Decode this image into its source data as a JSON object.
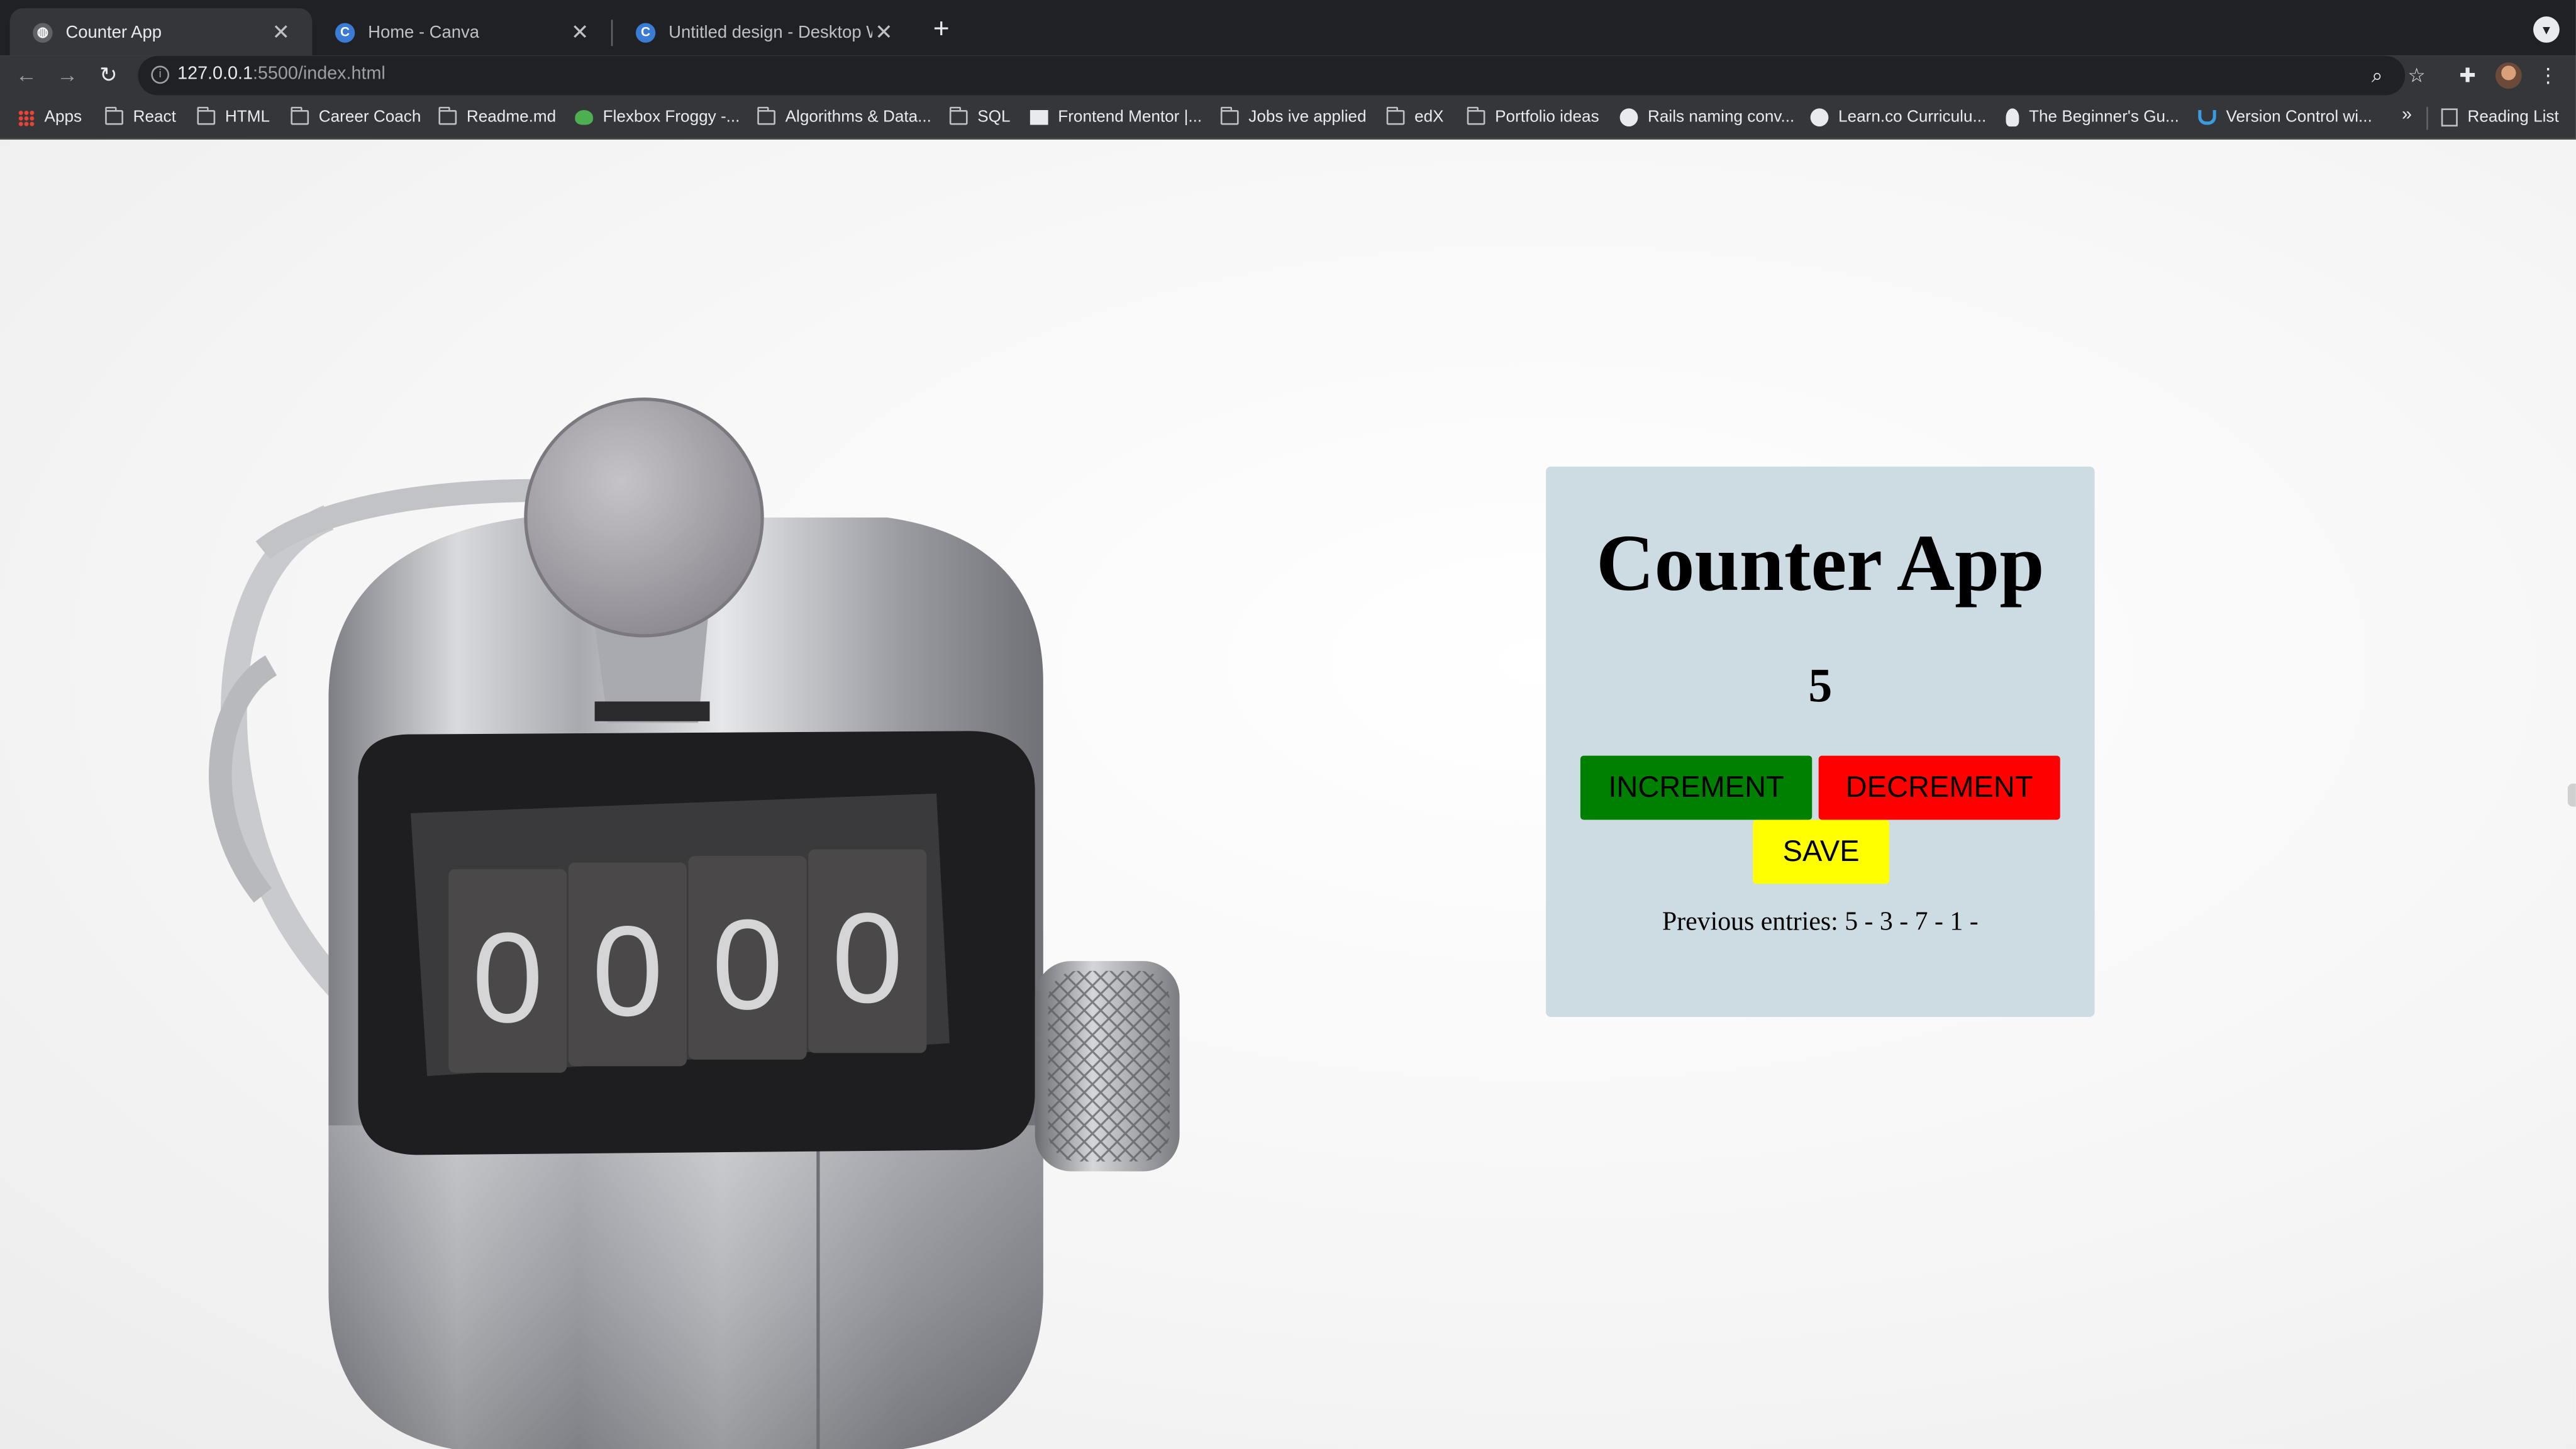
{
  "browser": {
    "tabs": [
      {
        "title": "Counter App",
        "active": true
      },
      {
        "title": "Home - Canva",
        "active": false
      },
      {
        "title": "Untitled design - Desktop Wall",
        "active": false
      }
    ],
    "url_host": "127.0.0.1",
    "url_rest": ":5500/index.html",
    "bookmarks": [
      "Apps",
      "React",
      "HTML",
      "Career Coach",
      "Readme.md",
      "Flexbox Froggy -...",
      "Algorithms & Data...",
      "SQL",
      "Frontend Mentor |...",
      "Jobs ive applied",
      "edX",
      "Portfolio ideas",
      "Rails naming conv...",
      "Learn.co Curriculu...",
      "The Beginner's Gu...",
      "Version Control wi..."
    ],
    "bookmarks_more": "»",
    "reading_list": "Reading List"
  },
  "counter_illustration": {
    "digits": [
      "0",
      "0",
      "0",
      "0"
    ]
  },
  "app": {
    "title": "Counter App",
    "count": "5",
    "increment_label": "INCREMENT",
    "decrement_label": "DECREMENT",
    "save_label": "SAVE",
    "previous_entries": "Previous entries: 5 - 3 - 7 - 1 -"
  },
  "colors": {
    "card_bg": "#cddbe2",
    "increment": "#008000",
    "decrement": "#ff0000",
    "save": "#ffff00"
  }
}
